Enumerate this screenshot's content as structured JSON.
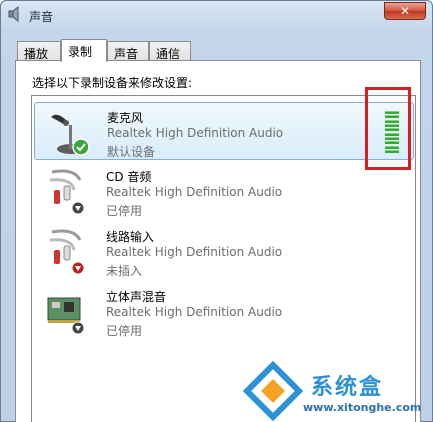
{
  "window": {
    "title": "声音",
    "close_label": "✕"
  },
  "tabs": [
    {
      "label": "播放",
      "active": false
    },
    {
      "label": "录制",
      "active": true
    },
    {
      "label": "声音",
      "active": false
    },
    {
      "label": "通信",
      "active": false
    }
  ],
  "instructions": "选择以下录制设备来修改设置:",
  "devices": [
    {
      "name": "麦克风",
      "driver": "Realtek High Definition Audio",
      "status": "默认设备",
      "icon": "microphone-icon",
      "badge": "default-check-icon",
      "selected": true
    },
    {
      "name": "CD 音频",
      "driver": "Realtek High Definition Audio",
      "status": "已停用",
      "icon": "audio-cable-icon",
      "badge": "disabled-arrow-icon",
      "selected": false
    },
    {
      "name": "线路输入",
      "driver": "Realtek High Definition Audio",
      "status": "未插入",
      "icon": "audio-cable-icon",
      "badge": "unplugged-icon",
      "selected": false
    },
    {
      "name": "立体声混音",
      "driver": "Realtek High Definition Audio",
      "status": "已停用",
      "icon": "sound-card-icon",
      "badge": "disabled-arrow-icon",
      "selected": false
    }
  ],
  "level_meter": {
    "bars": 10,
    "color": "#36a936"
  },
  "highlight_color": "#d42020",
  "watermark": {
    "name": "系统盒",
    "url": "www.xitonghe.com"
  }
}
